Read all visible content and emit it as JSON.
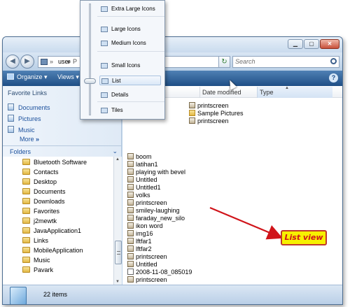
{
  "address": {
    "segment": "user",
    "partial": "P"
  },
  "search": {
    "placeholder": "Search"
  },
  "toolbar": {
    "organize": "Organize",
    "views": "Views"
  },
  "favorites": {
    "header": "Favorite Links",
    "items": [
      {
        "label": "Documents",
        "icon": "documents-icon"
      },
      {
        "label": "Pictures",
        "icon": "pictures-icon"
      },
      {
        "label": "Music",
        "icon": "music-icon"
      }
    ],
    "more": "More"
  },
  "folders": {
    "header": "Folders",
    "items": [
      "Bluetooth Software",
      "Contacts",
      "Desktop",
      "Documents",
      "Downloads",
      "Favorites",
      "j2mewtk",
      "JavaApplication1",
      "Links",
      "MobileApplication",
      "Music",
      "Pavark"
    ]
  },
  "columns": {
    "date_modified": "Date modified",
    "type": "Type"
  },
  "files": [
    {
      "name": "boom",
      "icon": "image"
    },
    {
      "name": "latihan1",
      "icon": "image"
    },
    {
      "name": "playing with bevel",
      "icon": "image"
    },
    {
      "name": "Untitled",
      "icon": "image"
    },
    {
      "name": "Untitled1",
      "icon": "image"
    },
    {
      "name": "volks",
      "icon": "image"
    },
    {
      "name": "printscreen",
      "icon": "image"
    },
    {
      "name": "smiley-laughing",
      "icon": "image"
    },
    {
      "name": "faraday_new_silo",
      "icon": "image"
    },
    {
      "name": "ikon word",
      "icon": "image"
    },
    {
      "name": "img16",
      "icon": "image"
    },
    {
      "name": "lftfar1",
      "icon": "image"
    },
    {
      "name": "lftfar2",
      "icon": "image"
    },
    {
      "name": "printscreen",
      "icon": "image"
    },
    {
      "name": "Untitled",
      "icon": "image"
    },
    {
      "name": "2008-11-08_085019",
      "icon": "doc"
    },
    {
      "name": "printscreen",
      "icon": "image"
    }
  ],
  "files_col2": [
    {
      "name": "printscreen",
      "icon": "image"
    },
    {
      "name": "Sample Pictures",
      "icon": "folder"
    },
    {
      "name": "printscreen",
      "icon": "image"
    }
  ],
  "status": {
    "count": "22 items"
  },
  "views_menu": {
    "items": [
      "Extra Large Icons",
      "Large Icons",
      "Medium Icons",
      "Small Icons",
      "List",
      "Details",
      "Tiles"
    ],
    "selected": "List"
  },
  "annotation": {
    "text": "List view",
    "arrow_color": "#d0141a"
  }
}
